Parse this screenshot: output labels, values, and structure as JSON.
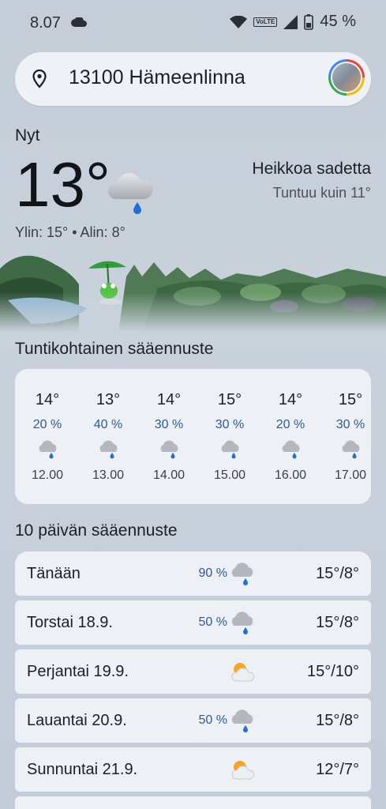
{
  "status": {
    "time": "8.07",
    "battery": "45 %",
    "volte": "VoLTE"
  },
  "search": {
    "location": "13100 Hämeenlinna"
  },
  "current": {
    "label": "Nyt",
    "temperature": "13°",
    "condition": "Heikkoa sadetta",
    "feels_like": "Tuntuu kuin 11°",
    "high_low": "Ylin: 15° • Alin: 8°"
  },
  "hourly": {
    "title": "Tuntikohtainen sääennuste",
    "items": [
      {
        "temp": "14°",
        "precip": "20 %",
        "time": "12.00",
        "icon": "rain-cloud-icon"
      },
      {
        "temp": "13°",
        "precip": "40 %",
        "time": "13.00",
        "icon": "rain-cloud-icon"
      },
      {
        "temp": "14°",
        "precip": "30 %",
        "time": "14.00",
        "icon": "rain-cloud-icon"
      },
      {
        "temp": "15°",
        "precip": "30 %",
        "time": "15.00",
        "icon": "rain-cloud-icon"
      },
      {
        "temp": "14°",
        "precip": "20 %",
        "time": "16.00",
        "icon": "rain-cloud-icon"
      },
      {
        "temp": "15°",
        "precip": "30 %",
        "time": "17.00",
        "icon": "rain-cloud-icon"
      }
    ]
  },
  "daily": {
    "title": "10 päivän sääennuste",
    "items": [
      {
        "day": "Tänään",
        "precip": "90 %",
        "temps": "15°/8°",
        "icon": "rain-cloud-icon"
      },
      {
        "day": "Torstai 18.9.",
        "precip": "50 %",
        "temps": "15°/8°",
        "icon": "rain-cloud-icon"
      },
      {
        "day": "Perjantai 19.9.",
        "precip": "",
        "temps": "15°/10°",
        "icon": "partly-cloudy-icon"
      },
      {
        "day": "Lauantai 20.9.",
        "precip": "50 %",
        "temps": "15°/8°",
        "icon": "rain-cloud-icon"
      },
      {
        "day": "Sunnuntai 21.9.",
        "precip": "",
        "temps": "12°/7°",
        "icon": "partly-cloudy-icon"
      }
    ]
  },
  "colors": {
    "precip_blue": "#2a5c9a",
    "card_bg": "#edf0f5",
    "sun": "#f5a623"
  }
}
